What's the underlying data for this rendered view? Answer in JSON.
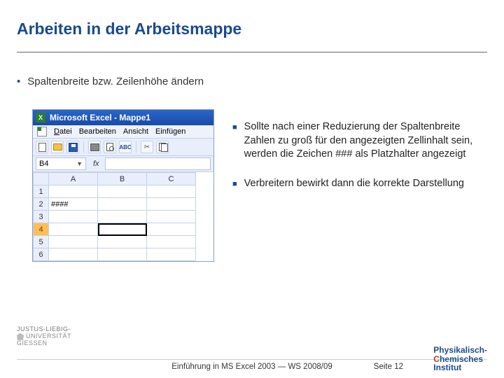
{
  "title": "Arbeiten in der Arbeitsmappe",
  "bullet1": "Spaltenbreite bzw. Zeilenhöhe ändern",
  "bullets_right": {
    "b1": "Sollte nach einer Reduzierung der Spaltenbreite Zahlen zu groß für den angezeigten Zellinhalt sein, werden die Zeichen ### als Platzhalter angezeigt",
    "b2": "Verbreitern bewirkt dann die korrekte Darstellung"
  },
  "excel": {
    "app_title": "Microsoft Excel - Mappe1",
    "menus": {
      "datei": "Datei",
      "bearbeiten": "Bearbeiten",
      "ansicht": "Ansicht",
      "einfuegen": "Einfügen"
    },
    "spell_label": "ABC",
    "namebox": "B4",
    "fx": "fx",
    "cols": [
      "A",
      "B",
      "C"
    ],
    "rows": [
      "1",
      "2",
      "3",
      "4",
      "5",
      "6"
    ],
    "cell_a2": "####"
  },
  "footer": {
    "uni_line1": "JUSTUS-LIEBIG-",
    "uni_line2": "UNIVERSITÄT",
    "uni_line3": "GIESSEN",
    "center": "Einführung in MS Excel 2003  ―  WS 2008/09",
    "page": "Seite 12",
    "inst_l1": "Physikalisch-",
    "inst_l2_a": "C",
    "inst_l2_b": "hemisches",
    "inst_l3": "Institut"
  }
}
